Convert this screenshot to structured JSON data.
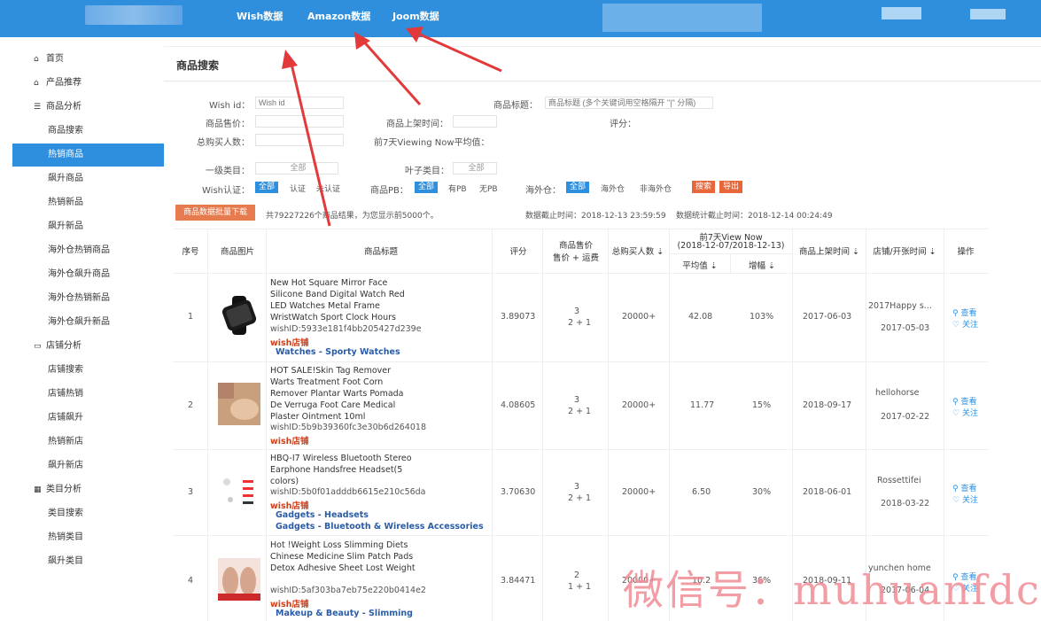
{
  "topnav": {
    "wish": "Wish数据",
    "amazon": "Amazon数据",
    "joom": "Joom数据"
  },
  "sidebar": {
    "items": [
      {
        "label": "首页",
        "icon": "home-icon"
      },
      {
        "label": "产品推荐",
        "icon": "home-icon"
      },
      {
        "label": "商品分析",
        "icon": "list-icon"
      },
      {
        "label": "商品搜索"
      },
      {
        "label": "热销商品"
      },
      {
        "label": "飙升商品"
      },
      {
        "label": "热销新品"
      },
      {
        "label": "飙升新品"
      },
      {
        "label": "海外仓热销商品"
      },
      {
        "label": "海外仓飙升商品"
      },
      {
        "label": "海外仓热销新品"
      },
      {
        "label": "海外仓飙升新品"
      },
      {
        "label": "店铺分析",
        "icon": "folder-icon"
      },
      {
        "label": "店铺搜索"
      },
      {
        "label": "店铺热销"
      },
      {
        "label": "店铺飙升"
      },
      {
        "label": "热销新店"
      },
      {
        "label": "飙升新店"
      },
      {
        "label": "类目分析",
        "icon": "grid-icon"
      },
      {
        "label": "类目搜索"
      },
      {
        "label": "热销类目"
      },
      {
        "label": "飙升类目"
      }
    ]
  },
  "panel": {
    "title": "商品搜索"
  },
  "filters": {
    "wishid_label": "Wish id：",
    "wishid_placeholder": "Wish id",
    "title_label": "商品标题：",
    "title_placeholder": "商品标题 (多个关键词用空格隔开 \"|\" 分隔)",
    "price_label": "商品售价：",
    "date_label": "商品上架时间：",
    "rating_label": "评分：",
    "buyers_label": "总购买人数：",
    "viewnow_label": "前7天Viewing Now平均值：",
    "cat1_label": "一级类目：",
    "cat1_value": "全部",
    "leaf_label": "叶子类目：",
    "leaf_value": "全部",
    "wishverify_label": "Wish认证：",
    "wv_all": "全部",
    "wv_yes": "认证",
    "wv_no": "未认证",
    "pb_label": "商品PB：",
    "pb_all": "全部",
    "pb_yes": "有PB",
    "pb_no": "无PB",
    "ow_label": "海外仓：",
    "ow_all": "全部",
    "ow_yes": "海外仓",
    "ow_no": "非海外仓",
    "search_btn": "搜索",
    "export_btn": "导出"
  },
  "summary": {
    "download_btn": "商品数据批量下载",
    "count_text": "共79227226个商品结果，为您显示前5000个。",
    "data_time": "数据截止时间：2018-12-13 23:59:59",
    "stat_time": "数据统计截止时间：2018-12-14 00:24:49"
  },
  "table": {
    "headers": {
      "index": "序号",
      "image": "商品图片",
      "title": "商品标题",
      "rating": "评分",
      "price": "商品售价",
      "price_sub": "售价 + 运费",
      "buyers": "总购买人数 ⇣",
      "view_title": "前7天View Now",
      "view_range": "(2018-12-07/2018-12-13)",
      "view_avg": "平均值 ⇣",
      "view_rank": "增幅 ⇣",
      "listed": "商品上架时间 ⇣",
      "shop": "店铺/开张时间 ⇣",
      "ops": "操作"
    },
    "rows": [
      {
        "index": "1",
        "title": "New Hot Square Mirror Face Silicone Band Digital Watch Red LED Watches Metal Frame WristWatch Sport Clock Hours",
        "wishid": "wishID:5933e181f4bb205427d239e",
        "wish_tag": "wish店铺",
        "cats": [
          "Watches - Sporty Watches"
        ],
        "rating": "3.89073",
        "price": "3",
        "ship": "2 + 1",
        "buyers": "20000+",
        "view_avg": "42.08",
        "view_rank": "103%",
        "listed": "2017-06-03",
        "shop": "2017Happy s...",
        "shop_date": "2017-05-03",
        "act_view": "查看",
        "act_follow": "关注"
      },
      {
        "index": "2",
        "title": "HOT SALE!Skin Tag Remover Warts Treatment Foot Corn Remover Plantar Warts Pomada De Verruga Foot Care Medical Plaster Ointment 10ml",
        "wishid": "wishID:5b9b39360fc3e30b6d264018",
        "wish_tag": "wish店铺",
        "cats": [],
        "rating": "4.08605",
        "price": "3",
        "ship": "2 + 1",
        "buyers": "20000+",
        "view_avg": "11.77",
        "view_rank": "15%",
        "listed": "2018-09-17",
        "shop": "hellohorse",
        "shop_date": "2017-02-22",
        "act_view": "查看",
        "act_follow": "关注"
      },
      {
        "index": "3",
        "title": "HBQ-I7 Wireless Bluetooth Stereo Earphone Handsfree Headset(5 colors)",
        "wishid": "wishID:5b0f01adddb6615e210c56da",
        "wish_tag": "wish店铺",
        "cats": [
          "Gadgets - Headsets",
          "Gadgets - Bluetooth & Wireless Accessories"
        ],
        "rating": "3.70630",
        "price": "3",
        "ship": "2 + 1",
        "buyers": "20000+",
        "view_avg": "6.50",
        "view_rank": "30%",
        "listed": "2018-06-01",
        "shop": "Rossettifei",
        "shop_date": "2018-03-22",
        "act_view": "查看",
        "act_follow": "关注"
      },
      {
        "index": "4",
        "title": "Hot !Weight Loss Slimming Diets Chinese Medicine Slim Patch Pads Detox Adhesive Sheet Lost Weight",
        "wishid": "wishID:5af303ba7eb75e220b0414e2",
        "wish_tag": "wish店铺",
        "cats": [
          "Makeup & Beauty - Slimming"
        ],
        "rating": "3.84471",
        "price": "2",
        "ship": "1 + 1",
        "buyers": "20000+",
        "view_avg": "10.2",
        "view_rank": "36%",
        "listed": "2018-09-11",
        "shop": "yunchen home",
        "shop_date": "2017-06-04",
        "act_view": "查看",
        "act_follow": "关注"
      }
    ]
  },
  "watermark": "微信号：muhuanfdc"
}
